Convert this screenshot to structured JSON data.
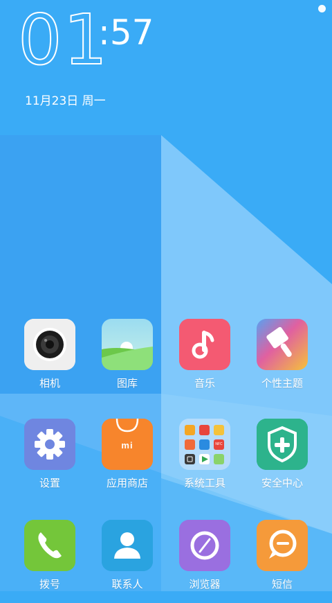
{
  "status": {
    "indicator": "status-dot"
  },
  "clock": {
    "hour": "01",
    "minute": ":57",
    "date": "11月23日 周一"
  },
  "apps": [
    {
      "label": "相机",
      "icon": "camera-icon",
      "color": "#eeeeee"
    },
    {
      "label": "图库",
      "icon": "gallery-icon",
      "color": "#8ee07a"
    },
    {
      "label": "音乐",
      "icon": "music-icon",
      "color": "#f45a72"
    },
    {
      "label": "个性主题",
      "icon": "theme-brush-icon",
      "color": "#8a7de8"
    },
    {
      "label": "设置",
      "icon": "gear-icon",
      "color": "#6f86e0"
    },
    {
      "label": "应用商店",
      "icon": "mi-store-icon",
      "color": "#f7852c",
      "badge_text": "mi"
    },
    {
      "label": "系统工具",
      "icon": "folder-icon",
      "color": "#a8d6fb",
      "folder_nfc": "NFC"
    },
    {
      "label": "安全中心",
      "icon": "shield-plus-icon",
      "color": "#2db38c"
    },
    {
      "label": "拨号",
      "icon": "phone-icon",
      "color": "#74c63a"
    },
    {
      "label": "联系人",
      "icon": "contact-icon",
      "color": "#2aa3e0"
    },
    {
      "label": "浏览器",
      "icon": "browser-icon",
      "color": "#9a6fe0"
    },
    {
      "label": "短信",
      "icon": "message-icon",
      "color": "#f59a3a"
    }
  ]
}
